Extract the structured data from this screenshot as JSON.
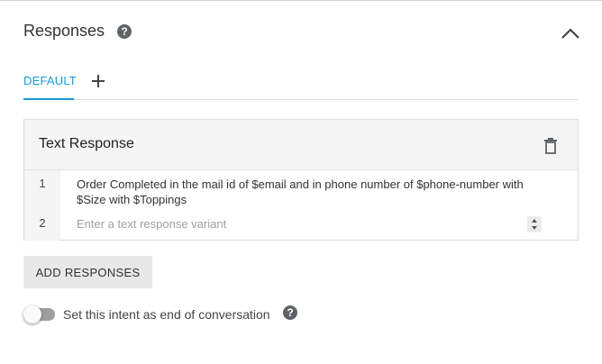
{
  "section": {
    "title": "Responses",
    "help_icon": "help-circle-icon",
    "collapse_icon": "chevron-up-icon"
  },
  "tabs": [
    {
      "label": "DEFAULT",
      "active": true
    }
  ],
  "add_tab_icon": "plus-icon",
  "card": {
    "title": "Text Response",
    "delete_icon": "trash-icon",
    "rows": [
      {
        "number": "1",
        "value": "Order Completed in the mail id of $email and in phone number of $phone-number with $Size with $Toppings"
      },
      {
        "number": "2",
        "value": "",
        "placeholder": "Enter a text response variant"
      }
    ]
  },
  "add_responses_label": "ADD RESPONSES",
  "end_conversation": {
    "label": "Set this intent as end of conversation",
    "enabled": false,
    "help_icon": "help-circle-icon"
  },
  "colors": {
    "accent": "#1a9bd7",
    "card_header_bg": "#f5f5f5",
    "button_bg": "#e8e8e8"
  }
}
